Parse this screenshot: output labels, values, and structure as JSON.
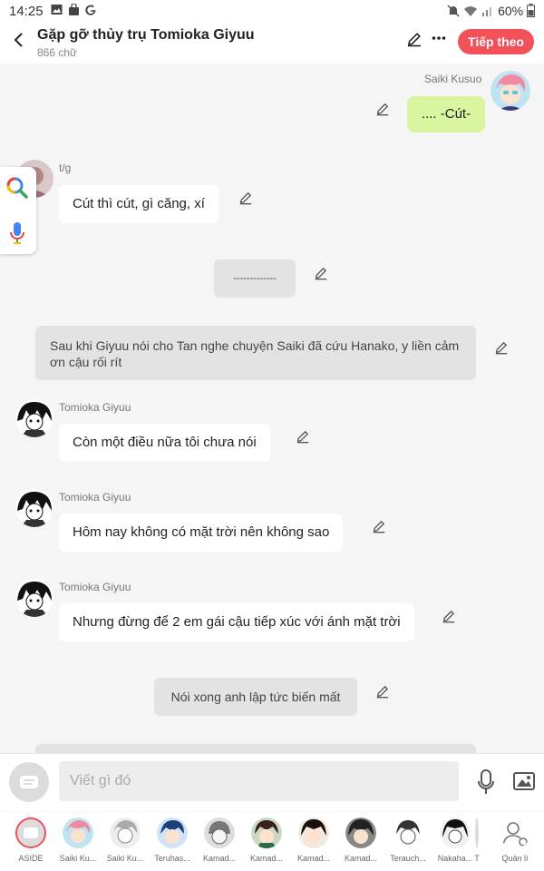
{
  "status_bar": {
    "time": "14:25",
    "left_icons": [
      "image-icon",
      "bag-icon",
      "google-icon"
    ],
    "right_icons": [
      "mute-icon",
      "wifi-icon",
      "signal-icon"
    ],
    "battery": "60%"
  },
  "header": {
    "title": "Gặp gỡ thủy trụ Tomioka Giyuu",
    "subtitle": "866 chữ",
    "next_label": "Tiếp theo",
    "accent_color": "#f2515a"
  },
  "messages": [
    {
      "type": "right",
      "sender": "Saiki Kusuo",
      "text": ".... -Cút-"
    },
    {
      "type": "left",
      "sender": "t/g",
      "text": "Cút thì cút, gì căng, xí"
    },
    {
      "type": "narration",
      "text": "-------------"
    },
    {
      "type": "narration",
      "text": "Sau khi Giyuu nói cho Tan nghe chuyện Saiki đã cứu Hanako, y liền cảm ơn cậu rối rít"
    },
    {
      "type": "left",
      "sender": "Tomioka Giyuu",
      "text": "Còn một điều nữa tôi chưa nói"
    },
    {
      "type": "left",
      "sender": "Tomioka Giyuu",
      "text": "Hôm nay không có mặt trời nên không sao"
    },
    {
      "type": "left",
      "sender": "Tomioka Giyuu",
      "text": "Nhưng đừng để 2 em gái cậu tiếp xúc với ánh mặt trời"
    },
    {
      "type": "narration",
      "text": "Nói xong anh lập tức biến mất"
    }
  ],
  "composer": {
    "placeholder": "Viết gì đó"
  },
  "characters": [
    {
      "name": "ASIDE"
    },
    {
      "name": "Saiki Ku..."
    },
    {
      "name": "Saiki Ku..."
    },
    {
      "name": "Teruhas..."
    },
    {
      "name": "Kamad..."
    },
    {
      "name": "Kamad..."
    },
    {
      "name": "Kamad..."
    },
    {
      "name": "Kamad..."
    },
    {
      "name": "Terauch..."
    },
    {
      "name": "Nakaha..."
    },
    {
      "name": "T"
    },
    {
      "name": "Quản lí"
    }
  ],
  "my_bubble_color": "#d9f5a0"
}
